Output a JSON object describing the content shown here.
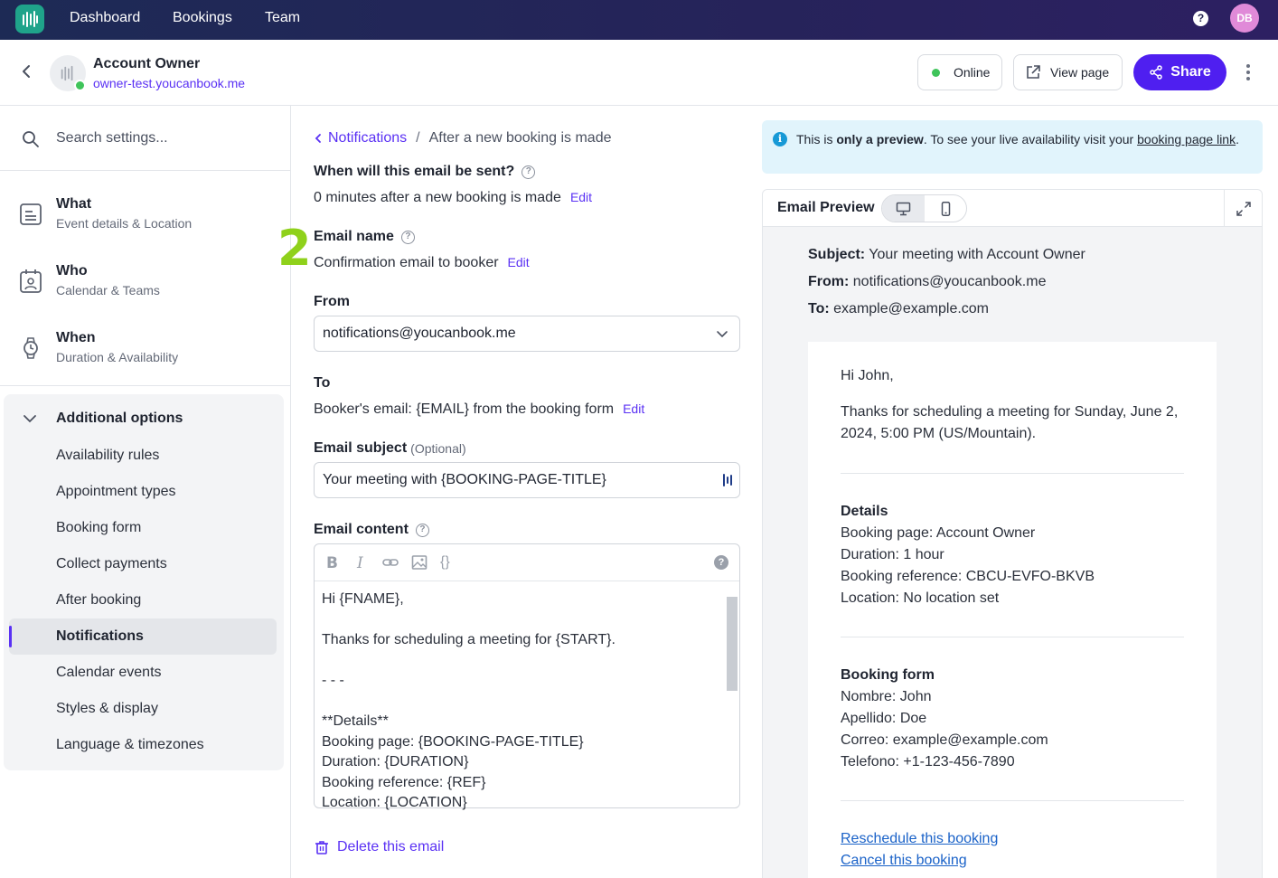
{
  "topnav": {
    "links": [
      "Dashboard",
      "Bookings",
      "Team"
    ],
    "help": "?",
    "avatar": "DB"
  },
  "header": {
    "account_name": "Account Owner",
    "account_url": "owner-test.youcanbook.me",
    "online_label": "Online",
    "view_page_label": "View page",
    "share_label": "Share"
  },
  "sidebar": {
    "search_placeholder": "Search settings...",
    "sections": [
      {
        "title": "What",
        "subtitle": "Event details & Location",
        "icon": "document-icon"
      },
      {
        "title": "Who",
        "subtitle": "Calendar & Teams",
        "icon": "user-calendar-icon"
      },
      {
        "title": "When",
        "subtitle": "Duration & Availability",
        "icon": "watch-icon"
      }
    ],
    "additional_title": "Additional options",
    "options": [
      "Availability rules",
      "Appointment types",
      "Booking form",
      "Collect payments",
      "After booking",
      "Notifications",
      "Calendar events",
      "Styles & display",
      "Language & timezones"
    ],
    "active_option": "Notifications"
  },
  "form": {
    "breadcrumb_link": "Notifications",
    "breadcrumb_sep": "/",
    "breadcrumb_current": "After a new booking is made",
    "when_label": "When will this email be sent?",
    "when_value": "0 minutes after a new booking is made",
    "edit_label": "Edit",
    "step_number": "2",
    "name_label": "Email name",
    "name_value": "Confirmation email to booker",
    "from_label": "From",
    "from_value": "notifications@youcanbook.me",
    "to_label": "To",
    "to_value": "Booker's email: {EMAIL} from the booking form",
    "subject_label": "Email subject",
    "subject_optional": "(Optional)",
    "subject_value": "Your meeting with {BOOKING-PAGE-TITLE}",
    "content_label": "Email content",
    "toolbar": {
      "bold": "B",
      "italic": "I",
      "braces": "{}",
      "help": "?"
    },
    "content_lines": "Hi {FNAME},\n\nThanks for scheduling a meeting for {START}.\n\n- - -\n\n**Details**\nBooking page: {BOOKING-PAGE-TITLE}\nDuration: {DURATION}\nBooking reference: {REF}\nLocation: {LOCATION}",
    "delete_label": "Delete this email"
  },
  "preview": {
    "info_prefix": "This is ",
    "info_bold": "only a preview",
    "info_mid": ". To see your live availability visit your ",
    "info_link": "booking page link",
    "info_end": ".",
    "title": "Email Preview",
    "subject_label": "Subject:",
    "subject_value": "Your meeting with Account Owner",
    "from_label": "From:",
    "from_value": "notifications@youcanbook.me",
    "to_label": "To:",
    "to_value": "example@example.com",
    "greeting": "Hi John,",
    "thanks": "Thanks for scheduling a meeting for Sunday, June 2, 2024, 5:00 PM (US/Mountain).",
    "details_title": "Details",
    "details": [
      "Booking page: Account Owner",
      "Duration: 1 hour",
      "Booking reference: CBCU-EVFO-BKVB",
      "Location: No location set"
    ],
    "form_title": "Booking form",
    "form_lines": [
      "Nombre: John",
      "Apellido: Doe",
      "Correo: example@example.com",
      "Telefono: +1-123-456-7890"
    ],
    "reschedule": "Reschedule this booking",
    "cancel": "Cancel this booking"
  },
  "colors": {
    "accent": "#5a31f4",
    "share": "#4f1ff0",
    "online": "#3fc45a",
    "step": "#8fd11b",
    "nav": "#23244f"
  }
}
